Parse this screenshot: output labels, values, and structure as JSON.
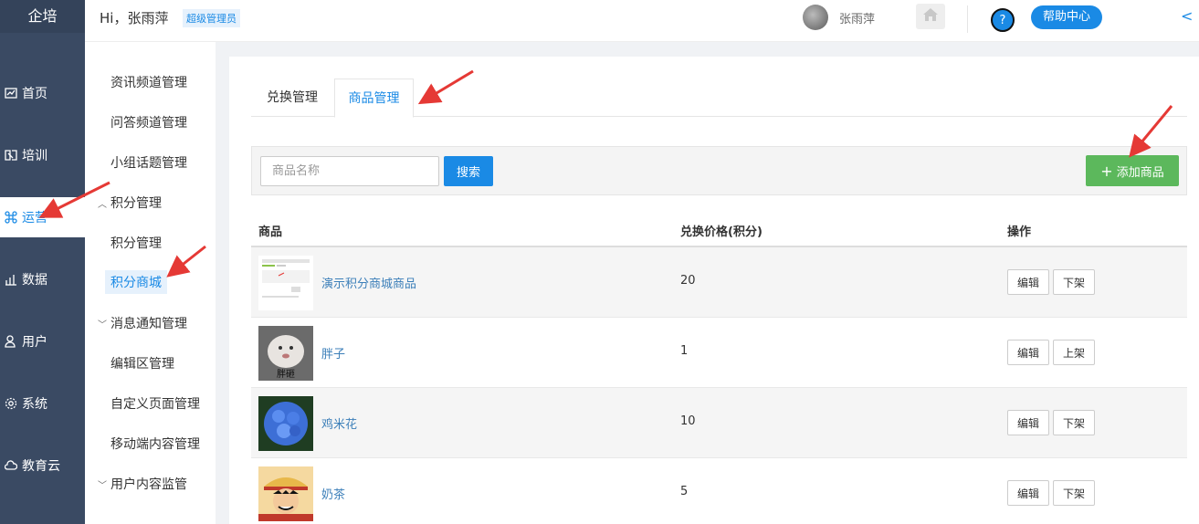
{
  "brand": "企培",
  "nav": [
    {
      "label": "首页",
      "icon": "chart-icon"
    },
    {
      "label": "培训",
      "icon": "book-icon"
    },
    {
      "label": "运营",
      "icon": "command-icon"
    },
    {
      "label": "数据",
      "icon": "bar-chart-icon"
    },
    {
      "label": "用户",
      "icon": "user-icon"
    },
    {
      "label": "系统",
      "icon": "gear-icon"
    },
    {
      "label": "教育云",
      "icon": "cloud-icon"
    }
  ],
  "submenu": {
    "items": [
      "资讯频道管理",
      "问答频道管理",
      "小组话题管理"
    ],
    "group_points": "积分管理",
    "points_children": [
      "积分管理",
      "积分商城"
    ],
    "group_notify": "消息通知管理",
    "notify_children": [
      "编辑区管理",
      "自定义页面管理",
      "移动端内容管理"
    ],
    "group_content": "用户内容监管"
  },
  "topbar": {
    "greeting": "Hi，张雨萍",
    "role_badge": "超级管理员",
    "username": "张雨萍",
    "help_icon_text": "?",
    "help_label": "帮助中心",
    "collapse_glyph": "<"
  },
  "tabs": [
    "兑换管理",
    "商品管理"
  ],
  "search": {
    "placeholder": "商品名称",
    "button": "搜索",
    "add_button": "添加商品",
    "add_icon": "+"
  },
  "table": {
    "headers": [
      "商品",
      "兑换价格(积分)",
      "操作"
    ],
    "rows": [
      {
        "name": "演示积分商城商品",
        "price": "20",
        "edit": "编辑",
        "toggle": "下架"
      },
      {
        "name": "胖子",
        "price": "1",
        "edit": "编辑",
        "toggle": "上架",
        "thumb_caption": "胖砸"
      },
      {
        "name": "鸡米花",
        "price": "10",
        "edit": "编辑",
        "toggle": "下架"
      },
      {
        "name": "奶茶",
        "price": "5",
        "edit": "编辑",
        "toggle": "下架"
      }
    ]
  },
  "colors": {
    "primary": "#1a8ae5",
    "nav_bg": "#3a4a63",
    "success": "#5cb85c",
    "arrow": "#e53935"
  }
}
